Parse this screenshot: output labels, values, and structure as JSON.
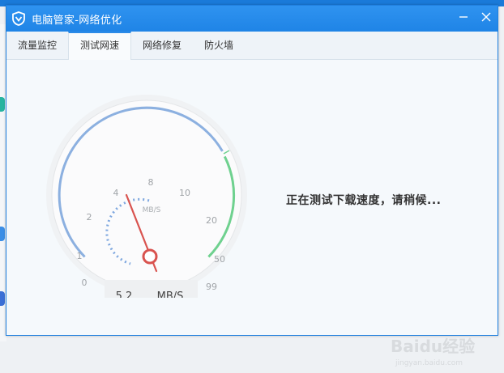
{
  "window": {
    "title": "电脑管家-网络优化"
  },
  "tabs": [
    {
      "label": "流量监控",
      "active": false
    },
    {
      "label": "测试网速",
      "active": true
    },
    {
      "label": "网络修复",
      "active": false
    },
    {
      "label": "防火墙",
      "active": false
    }
  ],
  "gauge": {
    "unit_label": "MB/S",
    "ticks": [
      "0",
      "1",
      "2",
      "4",
      "8",
      "10",
      "20",
      "50",
      "99"
    ],
    "readout_value": "5.2",
    "readout_unit": "MB/S"
  },
  "status_text": "正在测试下载速度，请稍候...",
  "watermark": {
    "brand": "Baidu经验",
    "url": "jingyan.baidu.com"
  },
  "colors": {
    "title_bar": "#2589ea",
    "gauge_blue": "#8cb0e0",
    "gauge_green": "#6fd18f",
    "needle": "#d9534f"
  }
}
